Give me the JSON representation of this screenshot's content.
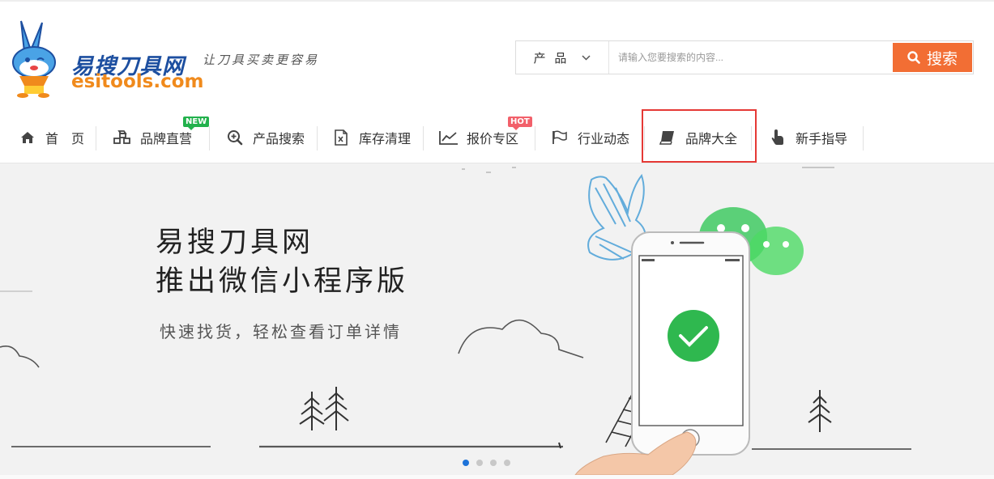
{
  "header": {
    "logo_cn": "易搜刀具网",
    "logo_en": "esitools.com",
    "slogan": "让刀具买卖更容易"
  },
  "search": {
    "category": "产 品",
    "placeholder": "请输入您要搜索的内容...",
    "button_label": "搜索"
  },
  "nav": {
    "items": [
      {
        "label": "首　页",
        "icon": "home-icon"
      },
      {
        "label": "品牌直营",
        "icon": "cubes-icon",
        "badge": "NEW"
      },
      {
        "label": "产品搜索",
        "icon": "search-plus-icon"
      },
      {
        "label": "库存清理",
        "icon": "excel-file-icon"
      },
      {
        "label": "报价专区",
        "icon": "line-chart-icon",
        "badge": "HOT"
      },
      {
        "label": "行业动态",
        "icon": "flag-icon"
      },
      {
        "label": "品牌大全",
        "icon": "book-icon"
      },
      {
        "label": "新手指导",
        "icon": "hand-pointer-icon"
      }
    ]
  },
  "banner": {
    "title_line1": "易搜刀具网",
    "title_line2": "推出微信小程序版",
    "subtitle": "快速找货，轻松查看订单详情",
    "slide_count": 4,
    "active_slide": 1
  },
  "colors": {
    "accent": "#f26e34",
    "logo_blue": "#1d4fa0",
    "logo_orange": "#f08a1c",
    "highlight": "#e53935",
    "dot_active": "#1e73d9"
  }
}
